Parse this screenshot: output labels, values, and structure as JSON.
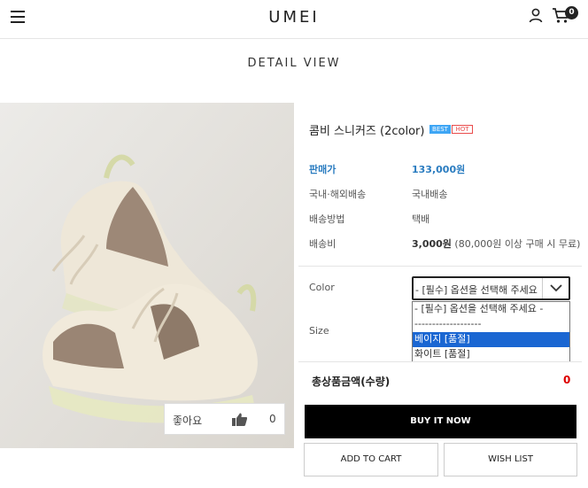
{
  "header": {
    "logo": "UMEI",
    "cart_count": "0",
    "menu_icon": "hamburger-menu-icon",
    "user_icon": "user-icon",
    "cart_icon": "cart-icon"
  },
  "page_title": "DETAIL VIEW",
  "like": {
    "label": "좋아요",
    "count": "0",
    "icon": "thumbs-up-icon"
  },
  "product": {
    "name": "콤비 스니커즈 (2color)",
    "badges": [
      "BEST",
      "HOT"
    ],
    "info": [
      {
        "label": "판매가",
        "value": "133,000원"
      },
      {
        "label": "국내·해외배송",
        "value": "국내배송"
      },
      {
        "label": "배송방법",
        "value": "택배"
      },
      {
        "label": "배송비",
        "value_bold": "3,000원",
        "value_rest": " (80,000원 이상 구매 시 무료)"
      }
    ]
  },
  "options": {
    "color_label": "Color",
    "size_label": "Size",
    "color_selected": "- [필수] 옵션을 선택해 주세요 -",
    "dropdown_items": [
      "- [필수] 옵션을 선택해 주세요 -",
      "-------------------",
      "베이지 [품절]",
      "화이트 [품절]"
    ],
    "highlighted_index": 2
  },
  "total": {
    "label": "총상품금액(수량)",
    "value": "0"
  },
  "buttons": {
    "buy": "BUY IT NOW",
    "cart": "ADD TO CART",
    "wish": "WISH LIST"
  },
  "colors": {
    "price_blue": "#2a7cc0",
    "best_badge": "#3ea6f5",
    "hot_badge": "#e94b4b",
    "total_red": "#d00000",
    "dropdown_highlight": "#1a66d2"
  }
}
